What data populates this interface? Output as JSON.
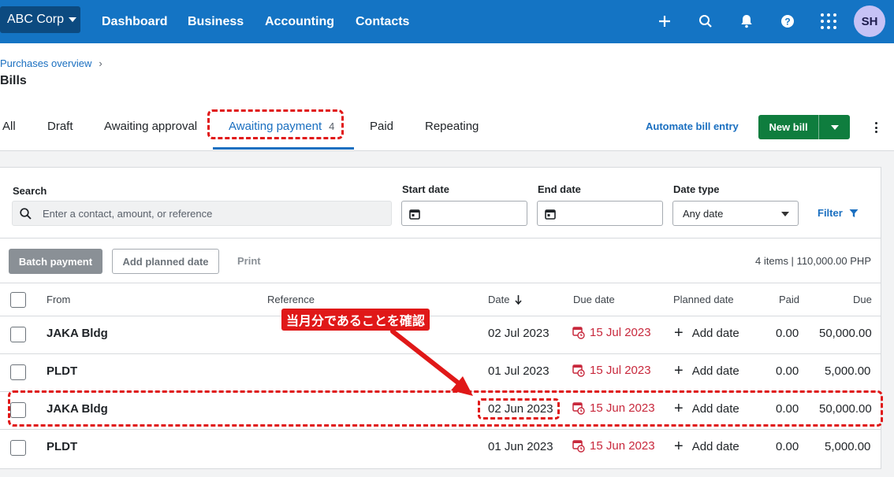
{
  "topnav": {
    "org_name": "ABC Corp",
    "items": [
      "Dashboard",
      "Business",
      "Accounting",
      "Contacts"
    ],
    "avatar_initials": "SH"
  },
  "header": {
    "breadcrumb": "Purchases overview",
    "title": "Bills",
    "tabs": [
      {
        "label": "All"
      },
      {
        "label": "Draft"
      },
      {
        "label": "Awaiting approval"
      },
      {
        "label": "Awaiting payment",
        "count": "4",
        "active": true
      },
      {
        "label": "Paid"
      },
      {
        "label": "Repeating"
      }
    ],
    "automate_label": "Automate bill entry",
    "new_bill_label": "New bill"
  },
  "filters": {
    "search_label": "Search",
    "search_placeholder": "Enter a contact, amount, or reference",
    "start_date_label": "Start date",
    "end_date_label": "End date",
    "date_type_label": "Date type",
    "date_type_value": "Any date",
    "filter_label": "Filter"
  },
  "actions": {
    "batch_payment": "Batch payment",
    "add_planned_date": "Add planned date",
    "print": "Print",
    "summary": "4 items | 110,000.00 PHP"
  },
  "table": {
    "headers": {
      "from": "From",
      "reference": "Reference",
      "date": "Date",
      "due_date": "Due date",
      "planned_date": "Planned date",
      "paid": "Paid",
      "due": "Due"
    },
    "rows": [
      {
        "from": "JAKA Bldg",
        "reference": "",
        "date": "02 Jul 2023",
        "due_date": "15 Jul 2023",
        "planned": "Add date",
        "paid": "0.00",
        "due": "50,000.00"
      },
      {
        "from": "PLDT",
        "reference": "",
        "date": "01 Jul 2023",
        "due_date": "15 Jul 2023",
        "planned": "Add date",
        "paid": "0.00",
        "due": "5,000.00"
      },
      {
        "from": "JAKA Bldg",
        "reference": "",
        "date": "02 Jun 2023",
        "due_date": "15 Jun 2023",
        "planned": "Add date",
        "paid": "0.00",
        "due": "50,000.00"
      },
      {
        "from": "PLDT",
        "reference": "",
        "date": "01 Jun 2023",
        "due_date": "15 Jun 2023",
        "planned": "Add date",
        "paid": "0.00",
        "due": "5,000.00"
      }
    ]
  },
  "annotation": {
    "callout": "当月分であることを確認",
    "color": "#e01818"
  },
  "colors": {
    "nav_blue": "#1474c4",
    "org_blue": "#0c4a80",
    "link_blue": "#1a6fc0",
    "green": "#0f7d3e",
    "overdue_red": "#c8283c"
  }
}
